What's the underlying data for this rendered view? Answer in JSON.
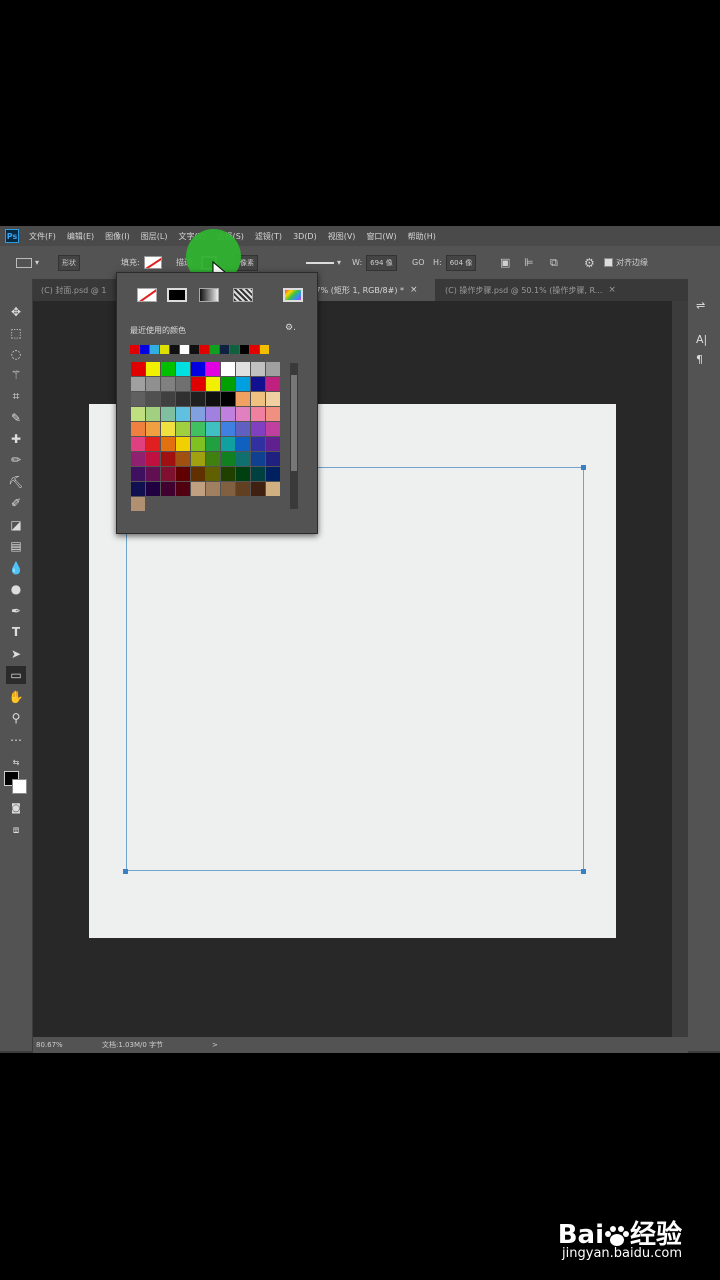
{
  "menu": {
    "logo": "Ps",
    "items": [
      "文件(F)",
      "编辑(E)",
      "图像(I)",
      "图层(L)",
      "文字(Y)",
      "选择(S)",
      "滤镜(T)",
      "3D(D)",
      "视图(V)",
      "窗口(W)",
      "帮助(H)"
    ]
  },
  "options": {
    "mode": "形状",
    "fill_label": "填充:",
    "stroke_label": "描边:",
    "stroke_unit": "像素",
    "w_label": "W:",
    "w_value": "694 像",
    "link": "GO",
    "h_label": "H:",
    "h_value": "604 像",
    "align_edges": "对齐边缘"
  },
  "tabs": [
    {
      "label": "(C) 封面.psd @ 1",
      "active": false
    },
    {
      "label": ".7% (矩形 1, RGB/8#) *",
      "active": true
    },
    {
      "label": "(C) 操作步骤.psd @ 50.1% (操作步骤, R...",
      "active": false
    }
  ],
  "picker": {
    "recent_label": "最近使用的颜色",
    "recent_colors": [
      "#e00000",
      "#0000e0",
      "#30b0e0",
      "#e0e000",
      "#101010",
      "#ffffff",
      "#101010",
      "#e00000",
      "#10a020",
      "#102040",
      "#106040",
      "#000000",
      "#e00000",
      "#f0c000"
    ],
    "swatches": [
      "#e00000",
      "#f0f000",
      "#00c000",
      "#00e0e0",
      "#0000e0",
      "#e000e0",
      "#ffffff",
      "#e0e0e0",
      "#c0c0c0",
      "#a0a0a0",
      "#a0a0a0",
      "#909090",
      "#808080",
      "#707070",
      "#e00000",
      "#f0f000",
      "#00a000",
      "#00a0e0",
      "#101090",
      "#c02080",
      "#606060",
      "#505050",
      "#404040",
      "#303030",
      "#202020",
      "#101010",
      "#000000",
      "#f0a060",
      "#f0c080",
      "#f0d0a0",
      "#c0e080",
      "#a0d080",
      "#80c0a0",
      "#60c0e0",
      "#80a0e0",
      "#a080e0",
      "#c080e0",
      "#e080c0",
      "#f080a0",
      "#f09080",
      "#f08040",
      "#f0a040",
      "#f0e040",
      "#a0d040",
      "#40c060",
      "#40c0c0",
      "#4080e0",
      "#6060c0",
      "#8040c0",
      "#c040a0",
      "#e04080",
      "#e02020",
      "#e07010",
      "#f0d000",
      "#80c020",
      "#20a040",
      "#10a0a0",
      "#1060c0",
      "#3030a0",
      "#602090",
      "#902070",
      "#c01040",
      "#a01010",
      "#a05010",
      "#a0a010",
      "#408010",
      "#108020",
      "#107070",
      "#104090",
      "#202080",
      "#401060",
      "#601050",
      "#801030",
      "#600000",
      "#603000",
      "#606000",
      "#204000",
      "#004010",
      "#004040",
      "#002060",
      "#101050",
      "#200040",
      "#400030",
      "#500010",
      "#c0a080",
      "#a08060",
      "#806040",
      "#604020",
      "#402010",
      "#d0b080",
      "#b09070"
    ]
  },
  "status": {
    "zoom": "80.67%",
    "doc": "文档:1.03M/0 字节",
    "arrow": ">"
  },
  "watermark": {
    "brand": "Bai",
    "brand2": "经验",
    "url": "jingyan.baidu.com"
  }
}
